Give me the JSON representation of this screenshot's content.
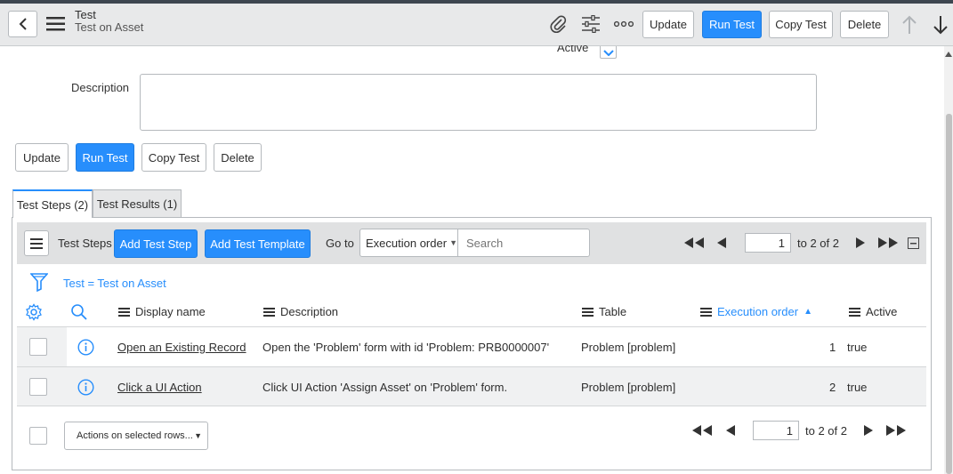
{
  "header": {
    "title": "Test",
    "subtitle": "Test on Asset",
    "buttons": {
      "update": "Update",
      "run_test": "Run Test",
      "copy_test": "Copy Test",
      "delete": "Delete"
    }
  },
  "form": {
    "active_label": "Active",
    "description_label": "Description",
    "buttons": {
      "update": "Update",
      "run_test": "Run Test",
      "copy_test": "Copy Test",
      "delete": "Delete"
    }
  },
  "tabs": [
    {
      "label": "Test Steps (2)",
      "active": true
    },
    {
      "label": "Test Results (1)",
      "active": false
    }
  ],
  "list": {
    "title": "Test Steps",
    "add_step": "Add Test Step",
    "add_template": "Add Test Template",
    "goto_label": "Go to",
    "goto_field": "Execution order",
    "search_placeholder": "Search",
    "page_value": "1",
    "page_range": "to 2 of 2",
    "filter_text": "Test = Test on Asset",
    "columns": {
      "display_name": "Display name",
      "description": "Description",
      "table": "Table",
      "execution_order": "Execution order",
      "active": "Active"
    },
    "rows": [
      {
        "display_name": "Open an Existing Record",
        "description": "Open the 'Problem' form with id 'Problem: PRB0000007'",
        "table": "Problem [problem]",
        "order": "1",
        "active": "true"
      },
      {
        "display_name": "Click a UI Action",
        "description": "Click UI Action 'Assign Asset' on 'Problem' form.",
        "table": "Problem [problem]",
        "order": "2",
        "active": "true"
      }
    ],
    "actions_select": "Actions on selected rows...",
    "footer_page_value": "1",
    "footer_page_range": "to 2 of 2"
  },
  "colors": {
    "primary": "#278efc",
    "header_bg": "#e8e9ea",
    "sorted_column": "#278efc"
  }
}
